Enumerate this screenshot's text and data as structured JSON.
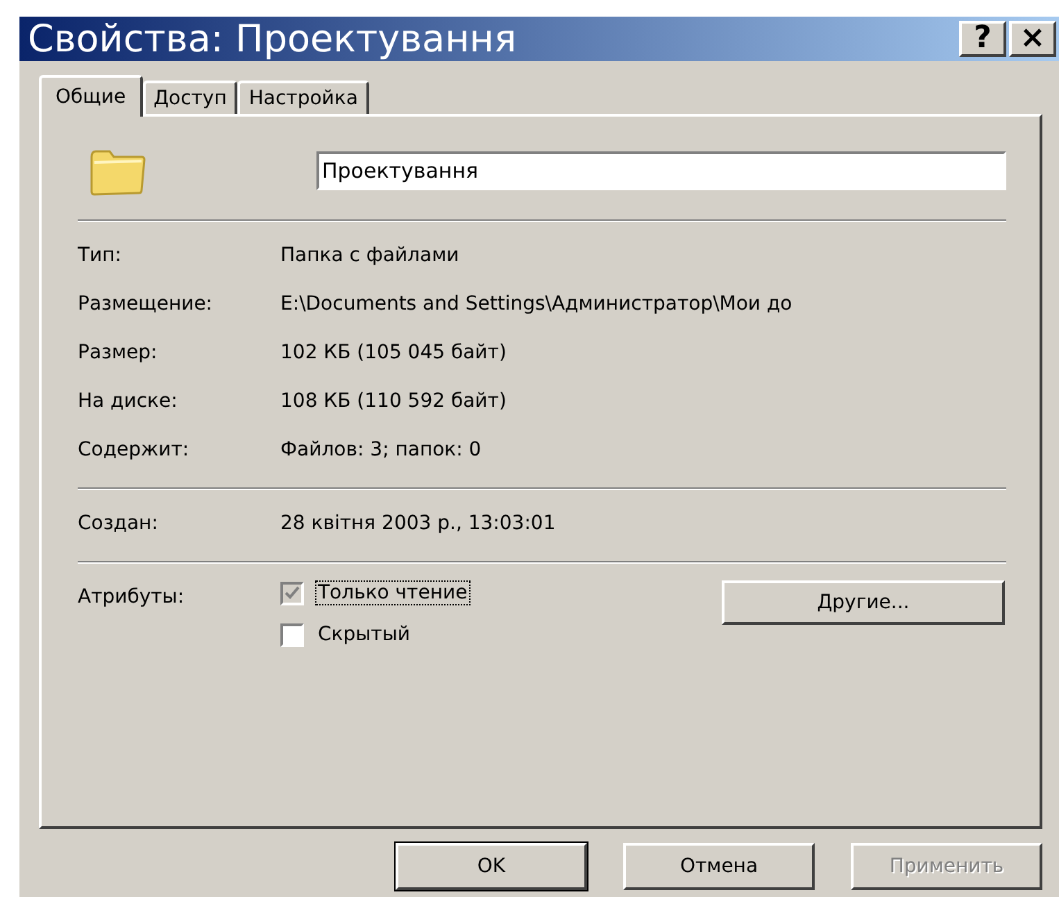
{
  "window": {
    "title": "Свойства: Проектування",
    "title_buttons": [
      {
        "label": "?"
      },
      {
        "label": "×"
      }
    ]
  },
  "tabs": [
    {
      "label": "Общие",
      "selected": true
    },
    {
      "label": "Доступ",
      "selected": false
    },
    {
      "label": "Настройка",
      "selected": false
    }
  ],
  "name_field": {
    "value": "Проектування"
  },
  "groups": [
    [
      {
        "label": "Тип:",
        "value": "Папка с файлами"
      },
      {
        "label": "Размещение:",
        "value": "E:\\Documents and Settings\\Администратор\\Мои до"
      },
      {
        "label": "Размер:",
        "value": "102 КБ (105 045 байт)"
      },
      {
        "label": "На диске:",
        "value": "108 КБ (110 592 байт)"
      },
      {
        "label": "Содержит:",
        "value": "Файлов: 3; папок: 0"
      }
    ],
    [
      {
        "label": "Создан:",
        "value": "28 квітня 2003 р., 13:03:01"
      }
    ]
  ],
  "attributes": {
    "label": "Атрибуты:",
    "items": [
      {
        "label": "Только чтение",
        "checked": true,
        "greyed": true,
        "focused": true
      },
      {
        "label": "Скрытый",
        "checked": false,
        "greyed": false,
        "focused": false
      }
    ],
    "button": {
      "label": "Другие..."
    }
  },
  "buttons": [
    {
      "label": "OK",
      "disabled": false,
      "default": true
    },
    {
      "label": "Отмена",
      "disabled": false,
      "default": false
    },
    {
      "label": "Применить",
      "disabled": true,
      "default": false
    }
  ]
}
